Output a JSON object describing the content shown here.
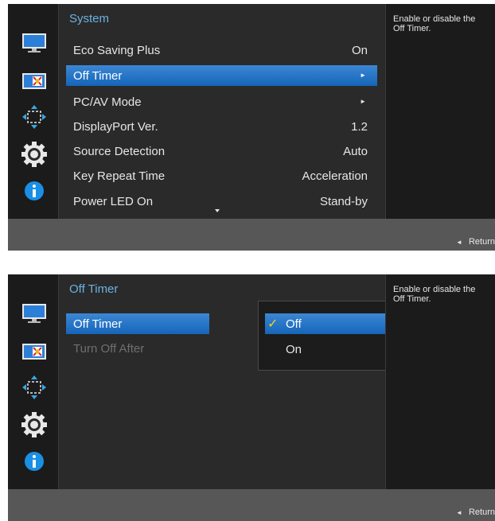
{
  "screen1": {
    "title": "System",
    "items": [
      {
        "label": "Eco Saving Plus",
        "value": "On"
      },
      {
        "label": "Off Timer",
        "value": "►"
      },
      {
        "label": "PC/AV Mode",
        "value": "►"
      },
      {
        "label": "DisplayPort Ver.",
        "value": "1.2"
      },
      {
        "label": "Source Detection",
        "value": "Auto"
      },
      {
        "label": "Key Repeat Time",
        "value": "Acceleration"
      },
      {
        "label": "Power LED On",
        "value": "Stand-by"
      }
    ],
    "help": [
      "Enable or disable the",
      "Off Timer."
    ],
    "return_label": "Return"
  },
  "screen2": {
    "title": "Off Timer",
    "items": [
      {
        "label": "Off Timer"
      },
      {
        "label": "Turn Off After"
      }
    ],
    "options": [
      {
        "label": "Off",
        "checked": true
      },
      {
        "label": "On",
        "checked": false
      }
    ],
    "help": [
      "Enable or disable the",
      "Off Timer."
    ],
    "return_label": "Return"
  },
  "sidebar_icons": [
    "picture-icon",
    "color-icon",
    "size-position-icon",
    "system-gear-icon",
    "information-icon"
  ],
  "colors": {
    "accent": "#1e6fc4",
    "title": "#6cb1e2",
    "check": "#f4d21c"
  }
}
